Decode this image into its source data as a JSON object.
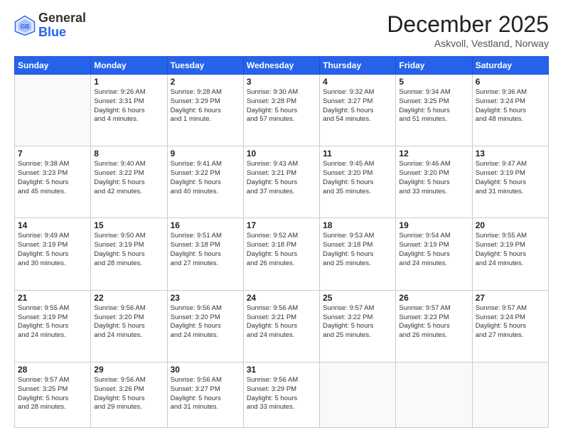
{
  "header": {
    "logo_general": "General",
    "logo_blue": "Blue",
    "month_title": "December 2025",
    "location": "Askvoll, Vestland, Norway"
  },
  "days_of_week": [
    "Sunday",
    "Monday",
    "Tuesday",
    "Wednesday",
    "Thursday",
    "Friday",
    "Saturday"
  ],
  "weeks": [
    [
      {
        "day": "",
        "info": ""
      },
      {
        "day": "1",
        "info": "Sunrise: 9:26 AM\nSunset: 3:31 PM\nDaylight: 6 hours\nand 4 minutes."
      },
      {
        "day": "2",
        "info": "Sunrise: 9:28 AM\nSunset: 3:29 PM\nDaylight: 6 hours\nand 1 minute."
      },
      {
        "day": "3",
        "info": "Sunrise: 9:30 AM\nSunset: 3:28 PM\nDaylight: 5 hours\nand 57 minutes."
      },
      {
        "day": "4",
        "info": "Sunrise: 9:32 AM\nSunset: 3:27 PM\nDaylight: 5 hours\nand 54 minutes."
      },
      {
        "day": "5",
        "info": "Sunrise: 9:34 AM\nSunset: 3:25 PM\nDaylight: 5 hours\nand 51 minutes."
      },
      {
        "day": "6",
        "info": "Sunrise: 9:36 AM\nSunset: 3:24 PM\nDaylight: 5 hours\nand 48 minutes."
      }
    ],
    [
      {
        "day": "7",
        "info": "Sunrise: 9:38 AM\nSunset: 3:23 PM\nDaylight: 5 hours\nand 45 minutes."
      },
      {
        "day": "8",
        "info": "Sunrise: 9:40 AM\nSunset: 3:22 PM\nDaylight: 5 hours\nand 42 minutes."
      },
      {
        "day": "9",
        "info": "Sunrise: 9:41 AM\nSunset: 3:22 PM\nDaylight: 5 hours\nand 40 minutes."
      },
      {
        "day": "10",
        "info": "Sunrise: 9:43 AM\nSunset: 3:21 PM\nDaylight: 5 hours\nand 37 minutes."
      },
      {
        "day": "11",
        "info": "Sunrise: 9:45 AM\nSunset: 3:20 PM\nDaylight: 5 hours\nand 35 minutes."
      },
      {
        "day": "12",
        "info": "Sunrise: 9:46 AM\nSunset: 3:20 PM\nDaylight: 5 hours\nand 33 minutes."
      },
      {
        "day": "13",
        "info": "Sunrise: 9:47 AM\nSunset: 3:19 PM\nDaylight: 5 hours\nand 31 minutes."
      }
    ],
    [
      {
        "day": "14",
        "info": "Sunrise: 9:49 AM\nSunset: 3:19 PM\nDaylight: 5 hours\nand 30 minutes."
      },
      {
        "day": "15",
        "info": "Sunrise: 9:50 AM\nSunset: 3:19 PM\nDaylight: 5 hours\nand 28 minutes."
      },
      {
        "day": "16",
        "info": "Sunrise: 9:51 AM\nSunset: 3:18 PM\nDaylight: 5 hours\nand 27 minutes."
      },
      {
        "day": "17",
        "info": "Sunrise: 9:52 AM\nSunset: 3:18 PM\nDaylight: 5 hours\nand 26 minutes."
      },
      {
        "day": "18",
        "info": "Sunrise: 9:53 AM\nSunset: 3:18 PM\nDaylight: 5 hours\nand 25 minutes."
      },
      {
        "day": "19",
        "info": "Sunrise: 9:54 AM\nSunset: 3:19 PM\nDaylight: 5 hours\nand 24 minutes."
      },
      {
        "day": "20",
        "info": "Sunrise: 9:55 AM\nSunset: 3:19 PM\nDaylight: 5 hours\nand 24 minutes."
      }
    ],
    [
      {
        "day": "21",
        "info": "Sunrise: 9:55 AM\nSunset: 3:19 PM\nDaylight: 5 hours\nand 24 minutes."
      },
      {
        "day": "22",
        "info": "Sunrise: 9:56 AM\nSunset: 3:20 PM\nDaylight: 5 hours\nand 24 minutes."
      },
      {
        "day": "23",
        "info": "Sunrise: 9:56 AM\nSunset: 3:20 PM\nDaylight: 5 hours\nand 24 minutes."
      },
      {
        "day": "24",
        "info": "Sunrise: 9:56 AM\nSunset: 3:21 PM\nDaylight: 5 hours\nand 24 minutes."
      },
      {
        "day": "25",
        "info": "Sunrise: 9:57 AM\nSunset: 3:22 PM\nDaylight: 5 hours\nand 25 minutes."
      },
      {
        "day": "26",
        "info": "Sunrise: 9:57 AM\nSunset: 3:23 PM\nDaylight: 5 hours\nand 26 minutes."
      },
      {
        "day": "27",
        "info": "Sunrise: 9:57 AM\nSunset: 3:24 PM\nDaylight: 5 hours\nand 27 minutes."
      }
    ],
    [
      {
        "day": "28",
        "info": "Sunrise: 9:57 AM\nSunset: 3:25 PM\nDaylight: 5 hours\nand 28 minutes."
      },
      {
        "day": "29",
        "info": "Sunrise: 9:56 AM\nSunset: 3:26 PM\nDaylight: 5 hours\nand 29 minutes."
      },
      {
        "day": "30",
        "info": "Sunrise: 9:56 AM\nSunset: 3:27 PM\nDaylight: 5 hours\nand 31 minutes."
      },
      {
        "day": "31",
        "info": "Sunrise: 9:56 AM\nSunset: 3:29 PM\nDaylight: 5 hours\nand 33 minutes."
      },
      {
        "day": "",
        "info": ""
      },
      {
        "day": "",
        "info": ""
      },
      {
        "day": "",
        "info": ""
      }
    ]
  ]
}
